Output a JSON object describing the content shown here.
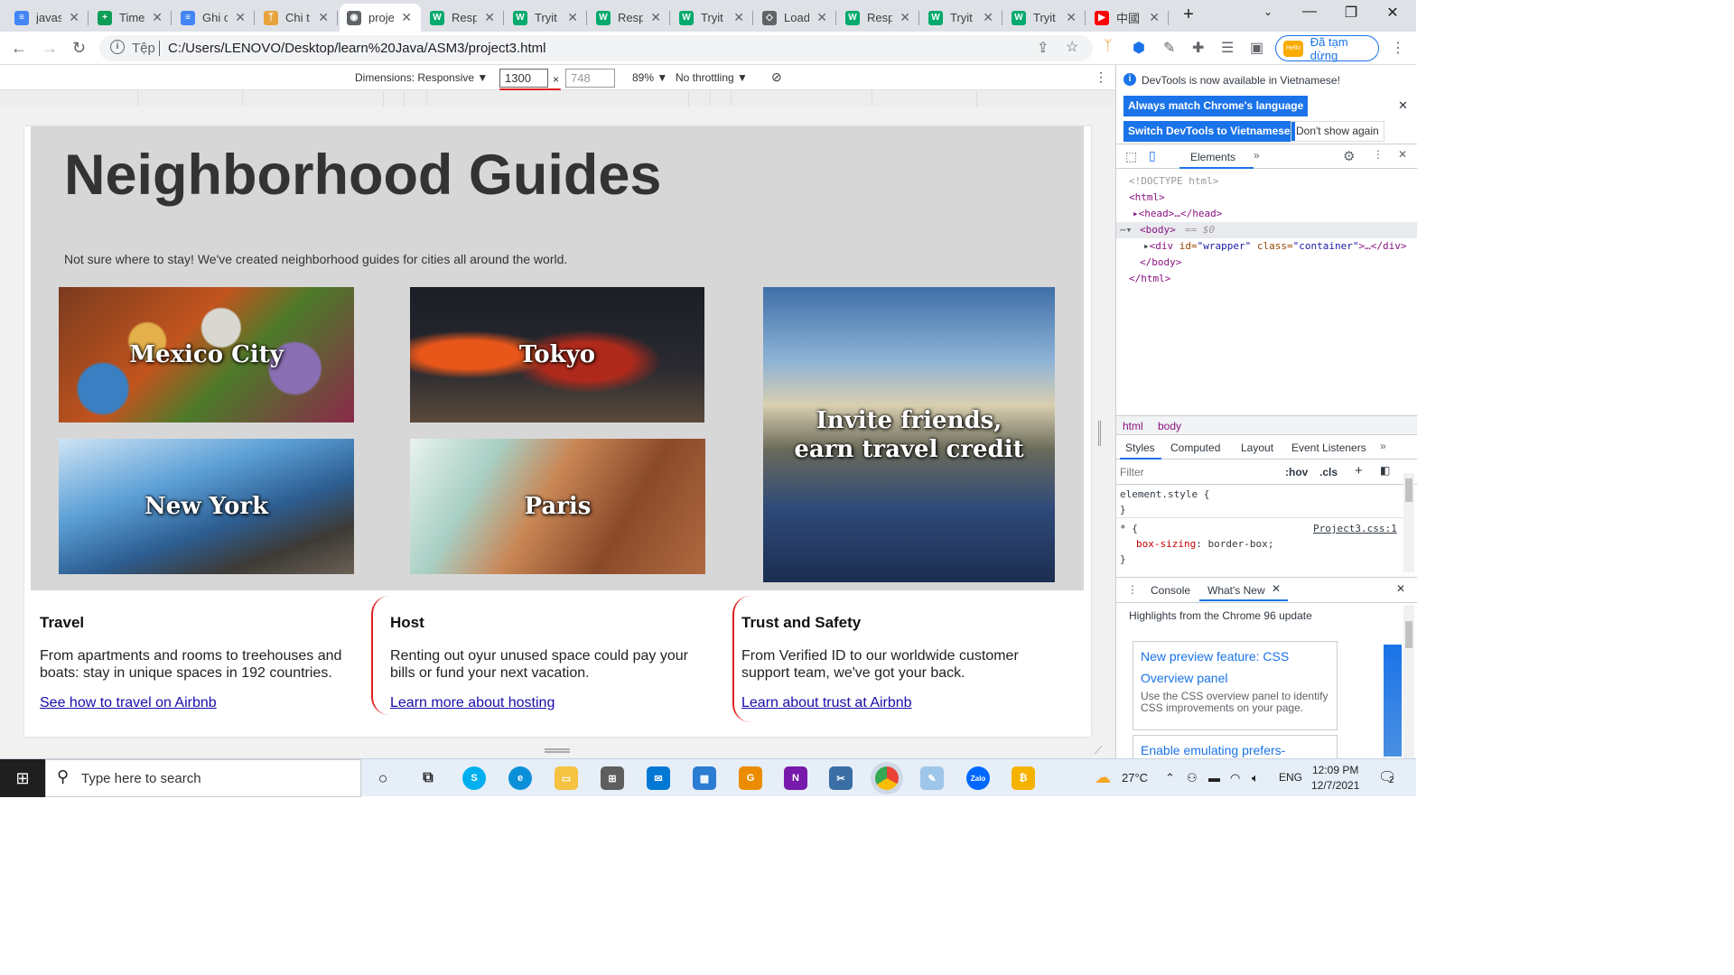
{
  "browser": {
    "tabs": [
      {
        "label": "javas",
        "icon": "docs-icon",
        "color": "#4285f4",
        "glyph": "≡"
      },
      {
        "label": "Time",
        "icon": "sheets-icon",
        "color": "#0f9d58",
        "glyph": "+"
      },
      {
        "label": "Ghi c",
        "icon": "docs-icon",
        "color": "#4285f4",
        "glyph": "≡"
      },
      {
        "label": "Chi t",
        "icon": "person-icon",
        "color": "#e8a33d",
        "glyph": "ᛉ"
      },
      {
        "label": "proje",
        "icon": "globe-icon",
        "color": "#5f6368",
        "glyph": "◉",
        "active": true
      },
      {
        "label": "Resp",
        "icon": "w3schools-icon",
        "color": "#04aa6d",
        "glyph": "W"
      },
      {
        "label": "Tryit",
        "icon": "w3schools-icon",
        "color": "#04aa6d",
        "glyph": "W"
      },
      {
        "label": "Resp",
        "icon": "w3schools-icon",
        "color": "#04aa6d",
        "glyph": "W"
      },
      {
        "label": "Tryit",
        "icon": "w3schools-icon",
        "color": "#04aa6d",
        "glyph": "W"
      },
      {
        "label": "Load",
        "icon": "code-icon",
        "color": "#5f6368",
        "glyph": "◇"
      },
      {
        "label": "Resp",
        "icon": "w3schools-icon",
        "color": "#04aa6d",
        "glyph": "W"
      },
      {
        "label": "Tryit",
        "icon": "w3schools-icon",
        "color": "#04aa6d",
        "glyph": "W"
      },
      {
        "label": "Tryit",
        "icon": "w3schools-icon",
        "color": "#04aa6d",
        "glyph": "W"
      },
      {
        "label": "中國",
        "icon": "youtube-icon",
        "color": "#ff0000",
        "glyph": "▶"
      }
    ],
    "address_protocol": "Tệp",
    "address_url": "C:/Users/LENOVO/Desktop/learn%20Java/ASM3/project3.html",
    "profile_status": "Đã tạm dừng"
  },
  "device_toolbar": {
    "dimensions_label": "Dimensions: Responsive ▼",
    "width": "1300",
    "times": "×",
    "height": "748",
    "zoom": "89% ▼",
    "throttling": "No throttling ▼"
  },
  "page": {
    "title": "Neighborhood Guides",
    "intro": "Not sure where to stay! We've created neighborhood guides for cities all around the world.",
    "tiles": {
      "mexico": "Mexico City",
      "tokyo": "Tokyo",
      "invite_line1": "Invite friends,",
      "invite_line2": "earn travel credit",
      "newyork": "New York",
      "paris": "Paris"
    },
    "columns": [
      {
        "heading": "Travel",
        "text": "From apartments and rooms to treehouses and boats: stay in unique spaces in 192 countries.",
        "link": "See how to travel on Airbnb"
      },
      {
        "heading": "Host",
        "text": "Renting out oyur unused space could pay your bills or fund your next vacation.",
        "link": "Learn more about hosting"
      },
      {
        "heading": "Trust and Safety",
        "text": "From Verified ID to our worldwide customer support team, we've got your back.",
        "link": "Learn about trust at Airbnb"
      }
    ]
  },
  "devtools": {
    "notice": "DevTools is now available in Vietnamese!",
    "btn_match": "Always match Chrome's language",
    "btn_switch": "Switch DevTools to Vietnamese",
    "btn_dont": "Don't show again",
    "tab_elements": "Elements",
    "dom": {
      "doctype": "<!DOCTYPE html>",
      "html_open": "<html>",
      "head": "<head>…</head>",
      "body_open": "<body>",
      "body_eq": "== $0",
      "div_tag": "<div",
      "div_id_attr": "id=",
      "div_id_val": "\"wrapper\"",
      "div_class_attr": "class=",
      "div_class_val": "\"container\"",
      "div_end": ">…</div>",
      "body_close": "</body>",
      "html_close": "</html>"
    },
    "crumb_html": "html",
    "crumb_body": "body",
    "styles_tabs": [
      "Styles",
      "Computed",
      "Layout",
      "Event Listeners"
    ],
    "filter_placeholder": "Filter",
    "hov": ":hov",
    "cls": ".cls",
    "rule1_selector": "element.style {",
    "rule1_close": "}",
    "rule2_selector": "* {",
    "rule2_source": "Project3.css:1",
    "rule2_prop": "box-sizing",
    "rule2_val": "border-box;",
    "rule2_close": "}",
    "drawer_console": "Console",
    "drawer_whatsnew": "What's New",
    "drawer_heading": "Highlights from the Chrome 96 update",
    "card1_title": "New preview feature: CSS Overview panel",
    "card1_text": "Use the CSS overview panel to identify CSS improvements on your page.",
    "card2_title": "Enable emulating prefers-"
  },
  "taskbar": {
    "search_placeholder": "Type here to search",
    "weather": "27°C",
    "language": "ENG",
    "time": "12:09 PM",
    "date": "12/7/2021",
    "notifications": "2"
  }
}
